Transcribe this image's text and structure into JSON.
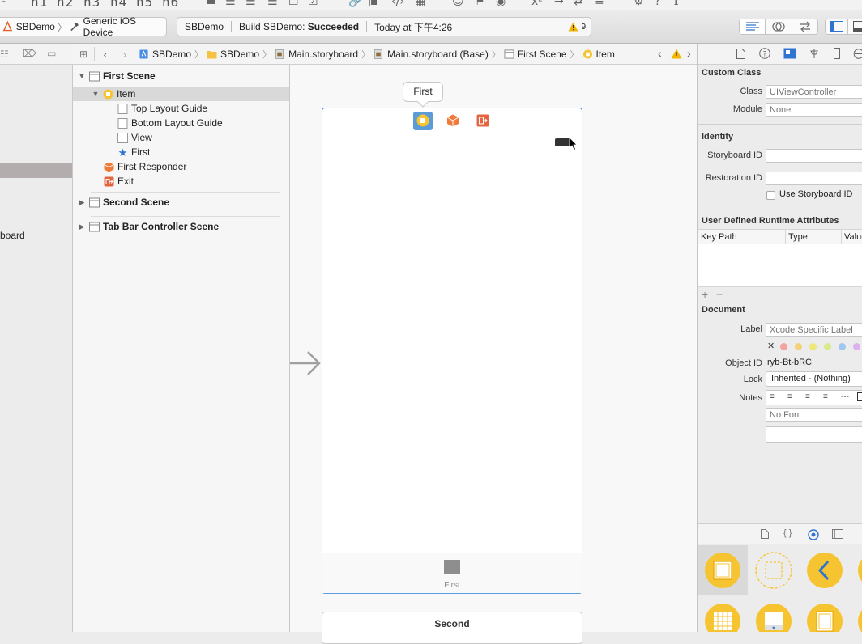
{
  "markdown_toolbar": {
    "headings": [
      "h1",
      "h2",
      "h3",
      "h4",
      "h5",
      "h6"
    ]
  },
  "toolbar": {
    "project_name": "SBDemo",
    "device_name": "Generic iOS Device",
    "activity": {
      "project": "SBDemo",
      "build_prefix": "Build SBDemo:",
      "build_status": "Succeeded",
      "timestamp": "Today at 下午4:26",
      "warning_count": "9"
    }
  },
  "left_pane": {
    "truncated_label": "board"
  },
  "jump_bar": {
    "crumbs": [
      "SBDemo",
      "SBDemo",
      "Main.storyboard",
      "Main.storyboard (Base)",
      "First Scene",
      "Item"
    ]
  },
  "outline": {
    "first_scene": "First Scene",
    "item": "Item",
    "top_layout_guide": "Top Layout Guide",
    "bottom_layout_guide": "Bottom Layout Guide",
    "view": "View",
    "first": "First",
    "first_responder": "First Responder",
    "exit": "Exit",
    "second_scene": "Second Scene",
    "tab_bar_controller_scene": "Tab Bar Controller Scene"
  },
  "canvas": {
    "scene_title": "First",
    "tab_item_label": "First",
    "second_scene_title": "Second"
  },
  "inspector": {
    "custom_class": {
      "heading": "Custom Class",
      "class_label": "Class",
      "class_placeholder": "UIViewController",
      "module_label": "Module",
      "module_placeholder": "None"
    },
    "identity": {
      "heading": "Identity",
      "storyboard_id_label": "Storyboard ID",
      "restoration_id_label": "Restoration ID",
      "use_storyboard_id_label": "Use Storyboard ID"
    },
    "runtime_attributes": {
      "heading": "User Defined Runtime Attributes",
      "columns": [
        "Key Path",
        "Type",
        "Value"
      ]
    },
    "document": {
      "heading": "Document",
      "label_label": "Label",
      "label_placeholder": "Xcode Specific Label",
      "object_id_label": "Object ID",
      "object_id_value": "ryb-Bt-bRC",
      "lock_label": "Lock",
      "lock_value": "Inherited - (Nothing)",
      "notes_label": "Notes",
      "font_placeholder": "No Font"
    }
  },
  "colors": {
    "accent": "#3a7bd5",
    "view_controller_yellow": "#f7c431",
    "first_responder_orange": "#f07a3c",
    "exit_red": "#e4643f"
  }
}
